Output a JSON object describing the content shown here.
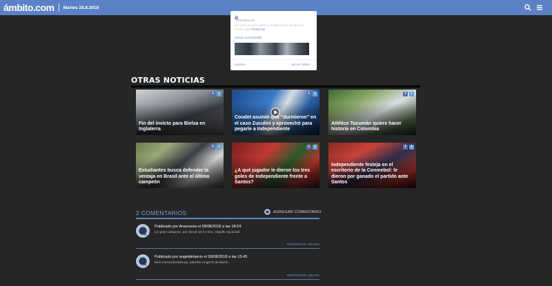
{
  "header": {
    "logo": "ámbito.com",
    "date": "Martes 28.8.2018",
    "bar_color": "#5b82c6",
    "icons": [
      "search-icon",
      "menu-icon"
    ]
  },
  "twitter_embed": {
    "avatar_letter": "a",
    "handle": "@ambitocom",
    "text_part1": "Así vivió un nuevo ajetreo el dólar hoy",
    "text_part2": "en un día con mucho más",
    "text_link": "#VelaDolar",
    "url": "ambito.com/932385",
    "embed_label": "Insertar",
    "view_label": "Ver en Twitter"
  },
  "otras_noticias": {
    "title": "OTRAS NOTICIAS",
    "items": [
      {
        "title": "Fin del invicto para Bielsa en Inglaterra"
      },
      {
        "title": "Coudet asumió que \"durmieron\" en el caso Zuculini y aprovechó para pegarle a Independiente",
        "video": true
      },
      {
        "title": "Atlético Tucumán quiere hacer historia en Colombia"
      },
      {
        "title": "Estudiantes busca defender la ventaja en Brasil ante el último campeón"
      },
      {
        "title": "¿A qué jugador le dieron los tres goles de Independiente frente a Santos?"
      },
      {
        "title": "Independiente festeja en el escritorio de la Conmebol: le dieron por ganado el partido ante Santos"
      }
    ],
    "share_fb": "f",
    "share_tw": "t"
  },
  "comments": {
    "title": "2 COMENTARIOS",
    "add_label": "AGREGAR COMENTARIO",
    "report_label": "REPORTAR ABUSO",
    "items": [
      {
        "author": "Publicado por Anacoreta el 28/08/2018 a las 18:24",
        "text": "Un gran campeón, por donde se lo mire. Orgullo nacional!"
      },
      {
        "author": "Publicado por angeldebarrio el 28/08/2018 a las 15:45",
        "text": "Bien merecido Manuaj. Saludos Angel R de Barrio"
      }
    ]
  },
  "colors": {
    "background": "#262626",
    "accent": "#5b82c6",
    "link": "#6f97d8"
  }
}
